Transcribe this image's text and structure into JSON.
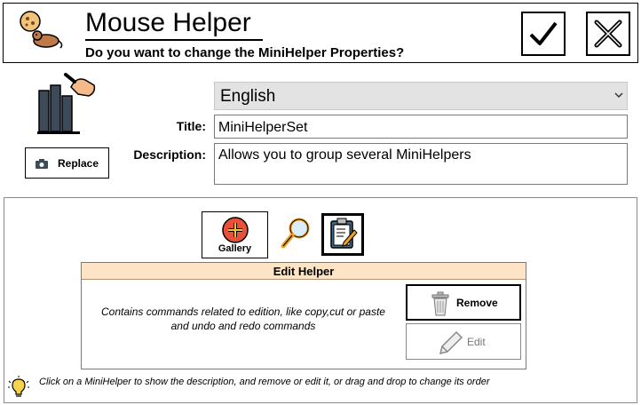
{
  "header": {
    "title": "Mouse Helper",
    "subtitle": "Do you want to change the MiniHelper Properties?",
    "confirm_icon": "checkmark-icon",
    "cancel_icon": "close-icon"
  },
  "properties": {
    "language": {
      "selected": "English"
    },
    "title_label": "Title:",
    "title_value": "MiniHelperSet",
    "description_label": "Description:",
    "description_value": "Allows you to group several MiniHelpers",
    "replace_button": "Replace"
  },
  "toolbar": {
    "gallery_label": "Gallery",
    "search_icon": "magnifier-icon",
    "edit_icon": "clipboard-pencil-icon"
  },
  "helper_card": {
    "title": "Edit Helper",
    "description": "Contains commands related to edition, like copy,cut or paste and undo and redo commands",
    "remove_label": "Remove",
    "edit_label": "Edit"
  },
  "hint": {
    "text": "Click on a MiniHelper to show the description, and remove or edit it, or drag and drop to change its order"
  },
  "colors": {
    "card_header_bg": "#fce4c5",
    "select_bg": "#e3e3e3",
    "gallery_red": "#e8503a"
  }
}
